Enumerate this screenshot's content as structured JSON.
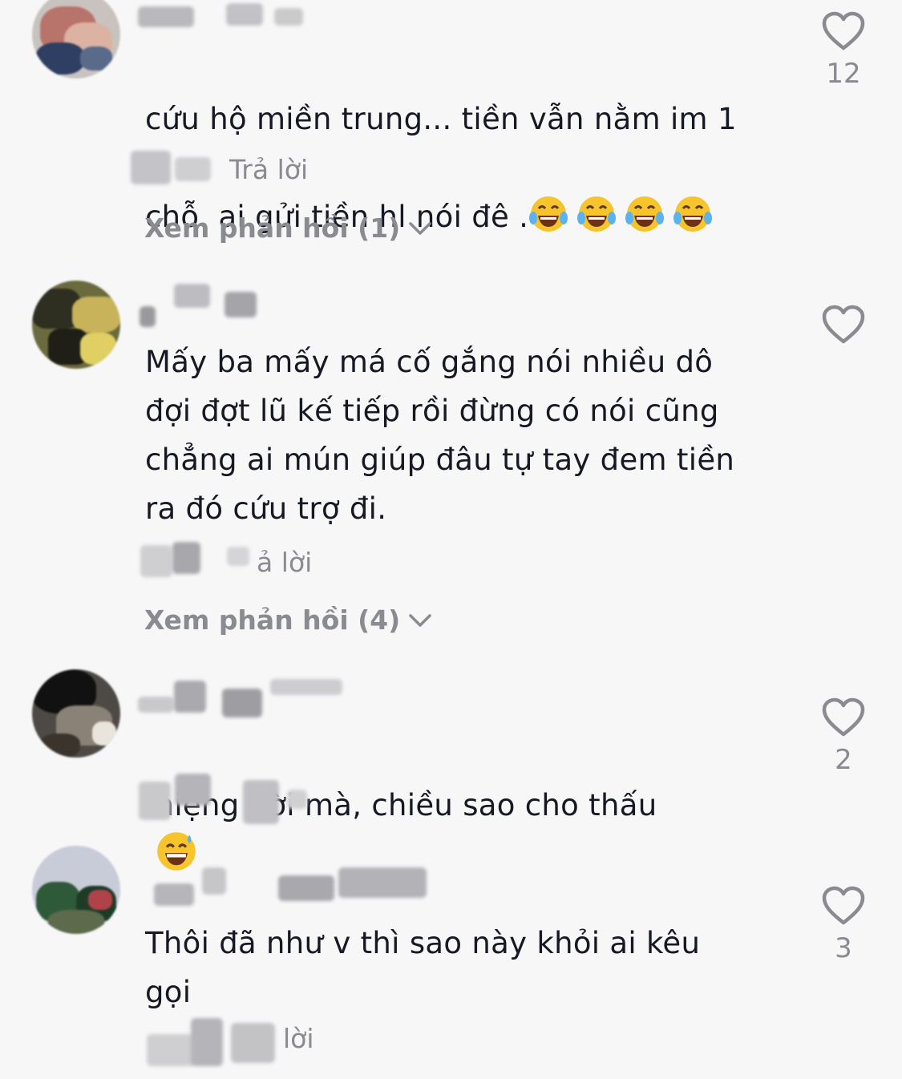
{
  "comments": [
    {
      "text_line1": "cứu hộ miền trung... tiền vẫn nằm im 1",
      "text_line2": "chỗ. ai gửi tiền hl nói đê .",
      "emoji": "😂😂😂😂",
      "emoji_icon": "face-with-tears-of-joy-icon",
      "reply_label": "Trả lời",
      "view_replies": "Xem phản hồi (1)",
      "like_count": "12"
    },
    {
      "text": "Mấy ba mấy má cố gắng nói nhiều dô\nđợi đợt lũ kế tiếp rồi đừng có nói cũng\nchẳng ai mún giúp đâu tự tay đem tiền\nra đó cứu trợ đi.",
      "reply_label": "ả lời",
      "view_replies": "Xem phản hồi (4)",
      "like_count": ""
    },
    {
      "text": "miệng đời mà, chiều sao cho thấu",
      "emoji": "😅",
      "emoji_icon": "grinning-face-with-sweat-icon",
      "like_count": "2"
    },
    {
      "text": "Thôi đã như v thì sao này khỏi ai kêu\ngọi",
      "reply_label": "lời",
      "like_count": "3"
    }
  ],
  "icons": {
    "like": "heart-outline-icon",
    "expand": "chevron-down-icon"
  },
  "colors": {
    "background": "#f7f7f8",
    "text": "#161823",
    "secondary": "#8a8b91"
  }
}
